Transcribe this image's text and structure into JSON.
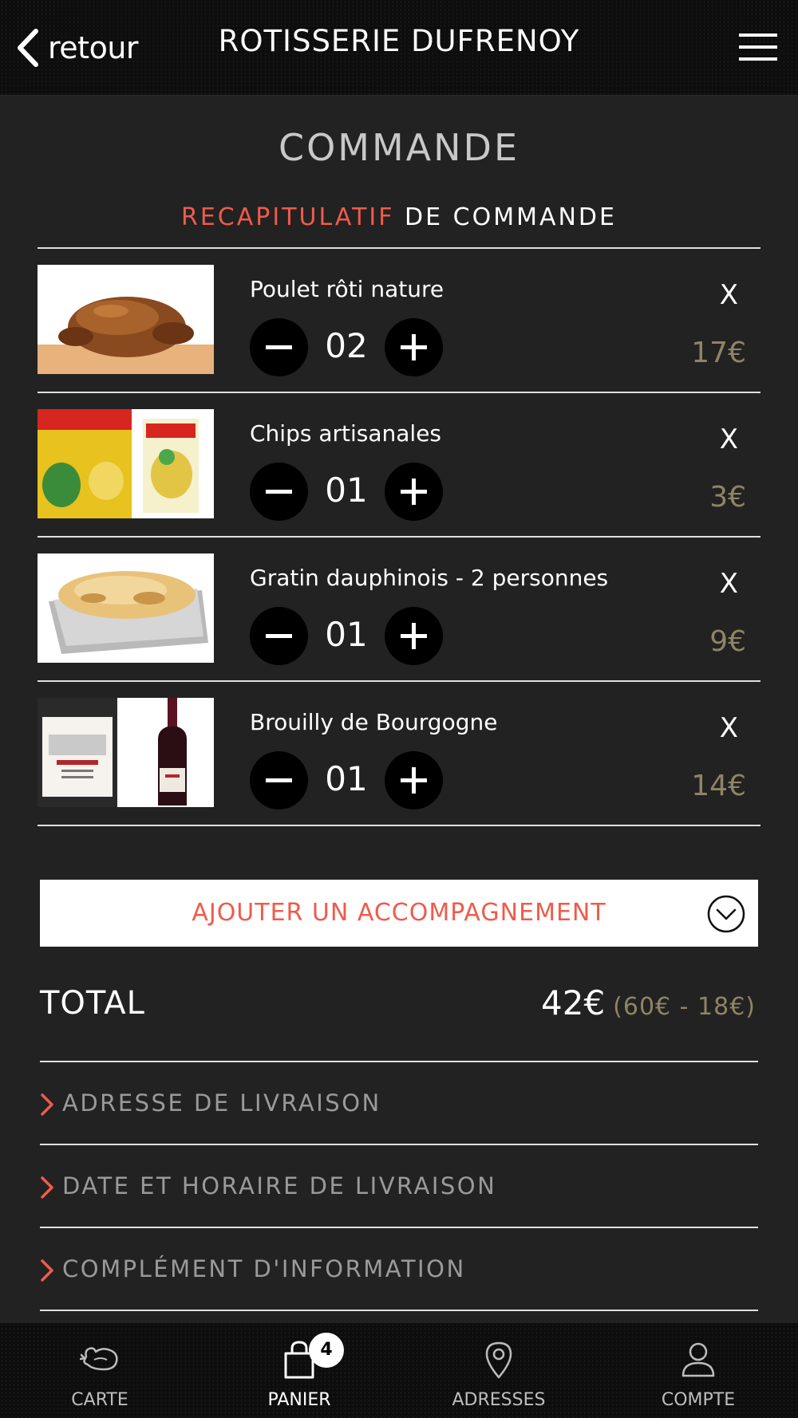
{
  "header": {
    "back_label": "retour",
    "title": "ROTISSERIE DUFRENOY"
  },
  "page": {
    "title": "COMMANDE",
    "subtitle_accent": "RECAPITULATIF",
    "subtitle_rest": "DE COMMANDE"
  },
  "items": [
    {
      "name": "Poulet rôti nature",
      "quantity": "02",
      "price": "17€",
      "remove": "X",
      "image": "roast-chicken"
    },
    {
      "name": "Chips artisanales",
      "quantity": "01",
      "price": "3€",
      "remove": "X",
      "image": "chips-bags"
    },
    {
      "name": "Gratin dauphinois - 2 personnes",
      "quantity": "01",
      "price": "9€",
      "remove": "X",
      "image": "gratin-tray"
    },
    {
      "name": "Brouilly de Bourgogne",
      "quantity": "01",
      "price": "14€",
      "remove": "X",
      "image": "wine-bottles"
    }
  ],
  "add_side": {
    "label": "AJOUTER UN ACCOMPAGNEMENT",
    "icon": "chevron-down-circle-icon"
  },
  "total": {
    "label": "TOTAL",
    "value": "42€",
    "detail": "(60€ - 18€)"
  },
  "sections": [
    {
      "label": "ADRESSE DE LIVRAISON"
    },
    {
      "label": "DATE ET HORAIRE DE LIVRAISON"
    },
    {
      "label": "COMPLÉMENT D'INFORMATION"
    }
  ],
  "nav": {
    "items": [
      {
        "label": "CARTE",
        "icon": "roast-chicken-icon"
      },
      {
        "label": "PANIER",
        "icon": "shopping-bag-icon",
        "badge": "4",
        "active": true
      },
      {
        "label": "ADRESSES",
        "icon": "map-pin-icon"
      },
      {
        "label": "COMPTE",
        "icon": "user-icon"
      }
    ]
  },
  "colors": {
    "background": "#222222",
    "header": "#0d0d0d",
    "accent": "#ef5b4c",
    "price": "#8f8464",
    "section_text": "#9a9a9a"
  }
}
